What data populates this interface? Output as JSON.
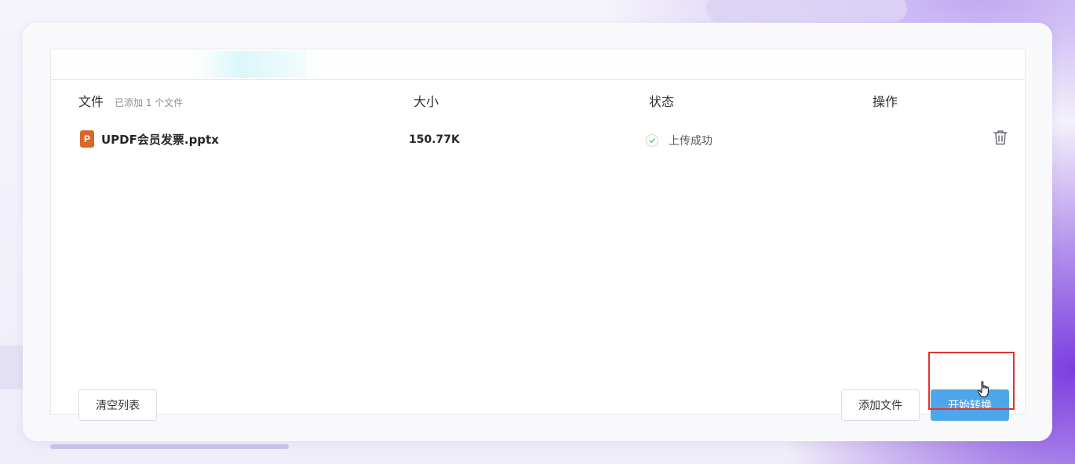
{
  "table": {
    "headers": {
      "file": "文件",
      "file_count": "已添加 1 个文件",
      "size": "大小",
      "status": "状态",
      "action": "操作"
    },
    "rows": [
      {
        "file_icon": "ppt-file-icon",
        "file_icon_letter": "P",
        "file_name": "UPDF会员发票.pptx",
        "size": "150.77K",
        "status_icon": "check-circle-icon",
        "status": "上传成功",
        "action_icon": "trash-icon"
      }
    ]
  },
  "footer": {
    "clear_label": "清空列表",
    "add_label": "添加文件",
    "start_label": "开始转换"
  },
  "colors": {
    "primary_button": "#4ea6ea",
    "highlight_border": "#e0352d",
    "file_icon": "#d9662a",
    "success_check": "#5cbf73",
    "background_accent": "#7c3ee0"
  }
}
